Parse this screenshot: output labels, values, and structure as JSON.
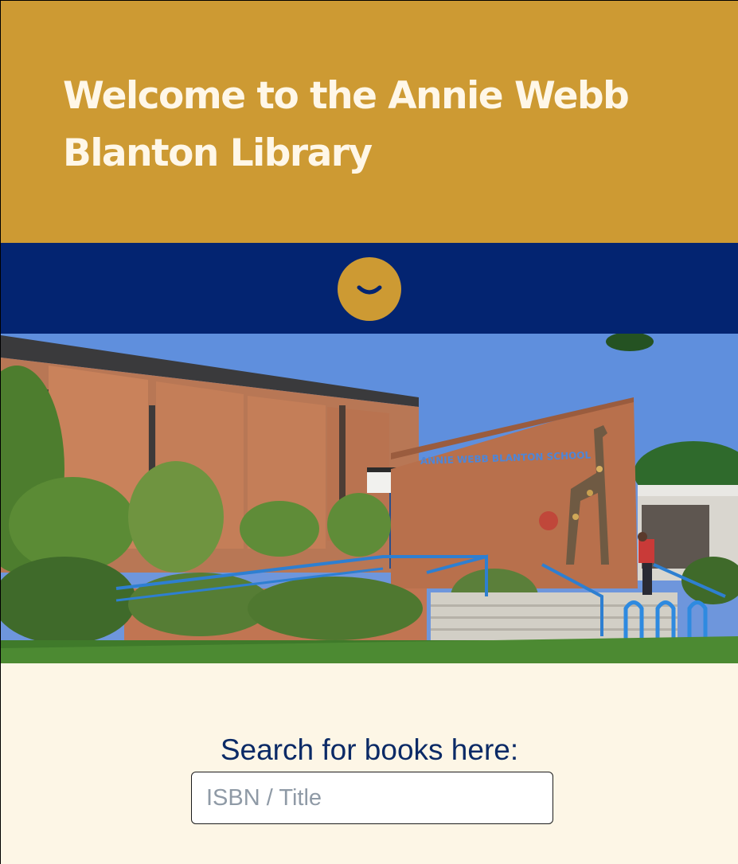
{
  "hero": {
    "title_line1": "Welcome to the Annie Webb",
    "title_line2": "Blanton Library",
    "background_color": "#cd9a33",
    "title_color": "#fff7e8"
  },
  "band": {
    "background_color": "#032471",
    "scroll_button": {
      "icon": "chevron-down-icon",
      "color": "#cd9a33"
    }
  },
  "photo": {
    "sign_text": "ANNIE WEBB BLANTON SCHOOL"
  },
  "search": {
    "label": "Search for books here:",
    "placeholder": "ISBN / Title",
    "value": ""
  },
  "colors": {
    "page_background": "#fdf6e6",
    "label_color": "#0b2a66"
  }
}
